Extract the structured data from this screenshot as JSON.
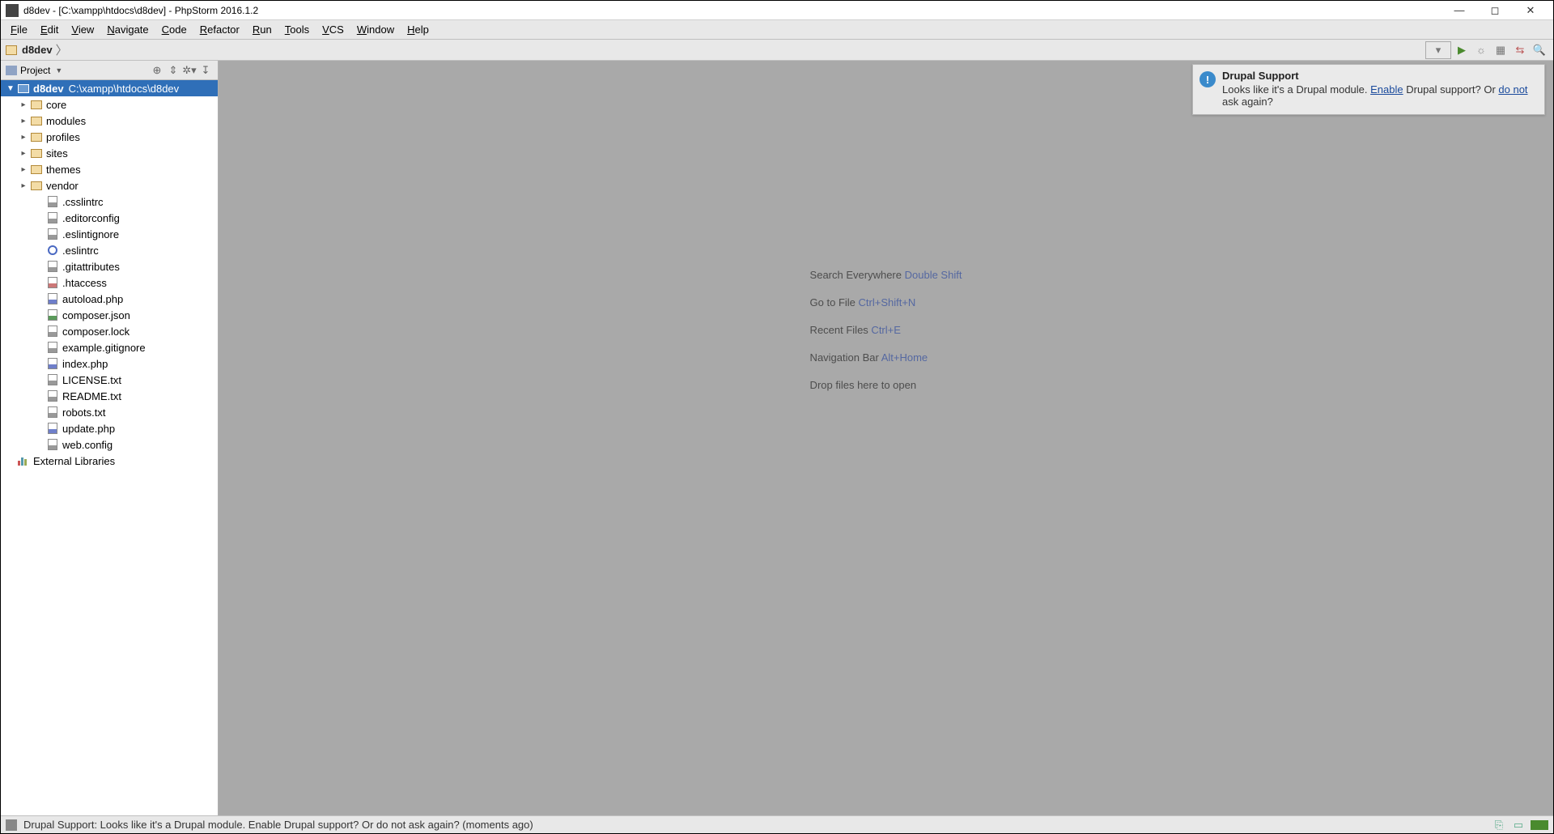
{
  "window": {
    "title": "d8dev - [C:\\xampp\\htdocs\\d8dev] - PhpStorm 2016.1.2"
  },
  "menu": {
    "items": [
      "File",
      "Edit",
      "View",
      "Navigate",
      "Code",
      "Refactor",
      "Run",
      "Tools",
      "VCS",
      "Window",
      "Help"
    ]
  },
  "breadcrumb": {
    "root": "d8dev"
  },
  "project_panel": {
    "title": "Project"
  },
  "tree": {
    "root": {
      "name": "d8dev",
      "path": "C:\\xampp\\htdocs\\d8dev"
    },
    "folders": [
      "core",
      "modules",
      "profiles",
      "sites",
      "themes",
      "vendor"
    ],
    "files": [
      {
        "name": ".csslintrc",
        "kind": "txt"
      },
      {
        "name": ".editorconfig",
        "kind": "txt"
      },
      {
        "name": ".eslintignore",
        "kind": "txt"
      },
      {
        "name": ".eslintrc",
        "kind": "gear"
      },
      {
        "name": ".gitattributes",
        "kind": "txt"
      },
      {
        "name": ".htaccess",
        "kind": "ht"
      },
      {
        "name": "autoload.php",
        "kind": "php"
      },
      {
        "name": "composer.json",
        "kind": "json"
      },
      {
        "name": "composer.lock",
        "kind": "txt"
      },
      {
        "name": "example.gitignore",
        "kind": "txt"
      },
      {
        "name": "index.php",
        "kind": "php"
      },
      {
        "name": "LICENSE.txt",
        "kind": "txt"
      },
      {
        "name": "README.txt",
        "kind": "txt"
      },
      {
        "name": "robots.txt",
        "kind": "txt"
      },
      {
        "name": "update.php",
        "kind": "php"
      },
      {
        "name": "web.config",
        "kind": "txt"
      }
    ],
    "external": "External Libraries"
  },
  "shortcuts": [
    {
      "label": "Search Everywhere ",
      "kb": "Double Shift"
    },
    {
      "label": "Go to File ",
      "kb": "Ctrl+Shift+N"
    },
    {
      "label": "Recent Files ",
      "kb": "Ctrl+E"
    },
    {
      "label": "Navigation Bar ",
      "kb": "Alt+Home"
    },
    {
      "label": "Drop files here to open",
      "kb": ""
    }
  ],
  "notification": {
    "title": "Drupal Support",
    "prefix": "Looks like it's a Drupal module. ",
    "link1": "Enable",
    "mid": " Drupal support? Or ",
    "link2": "do not",
    "suffix": " ask again?"
  },
  "status": {
    "message": "Drupal Support: Looks like it's a Drupal module. Enable Drupal support? Or do not ask again? (moments ago)"
  }
}
